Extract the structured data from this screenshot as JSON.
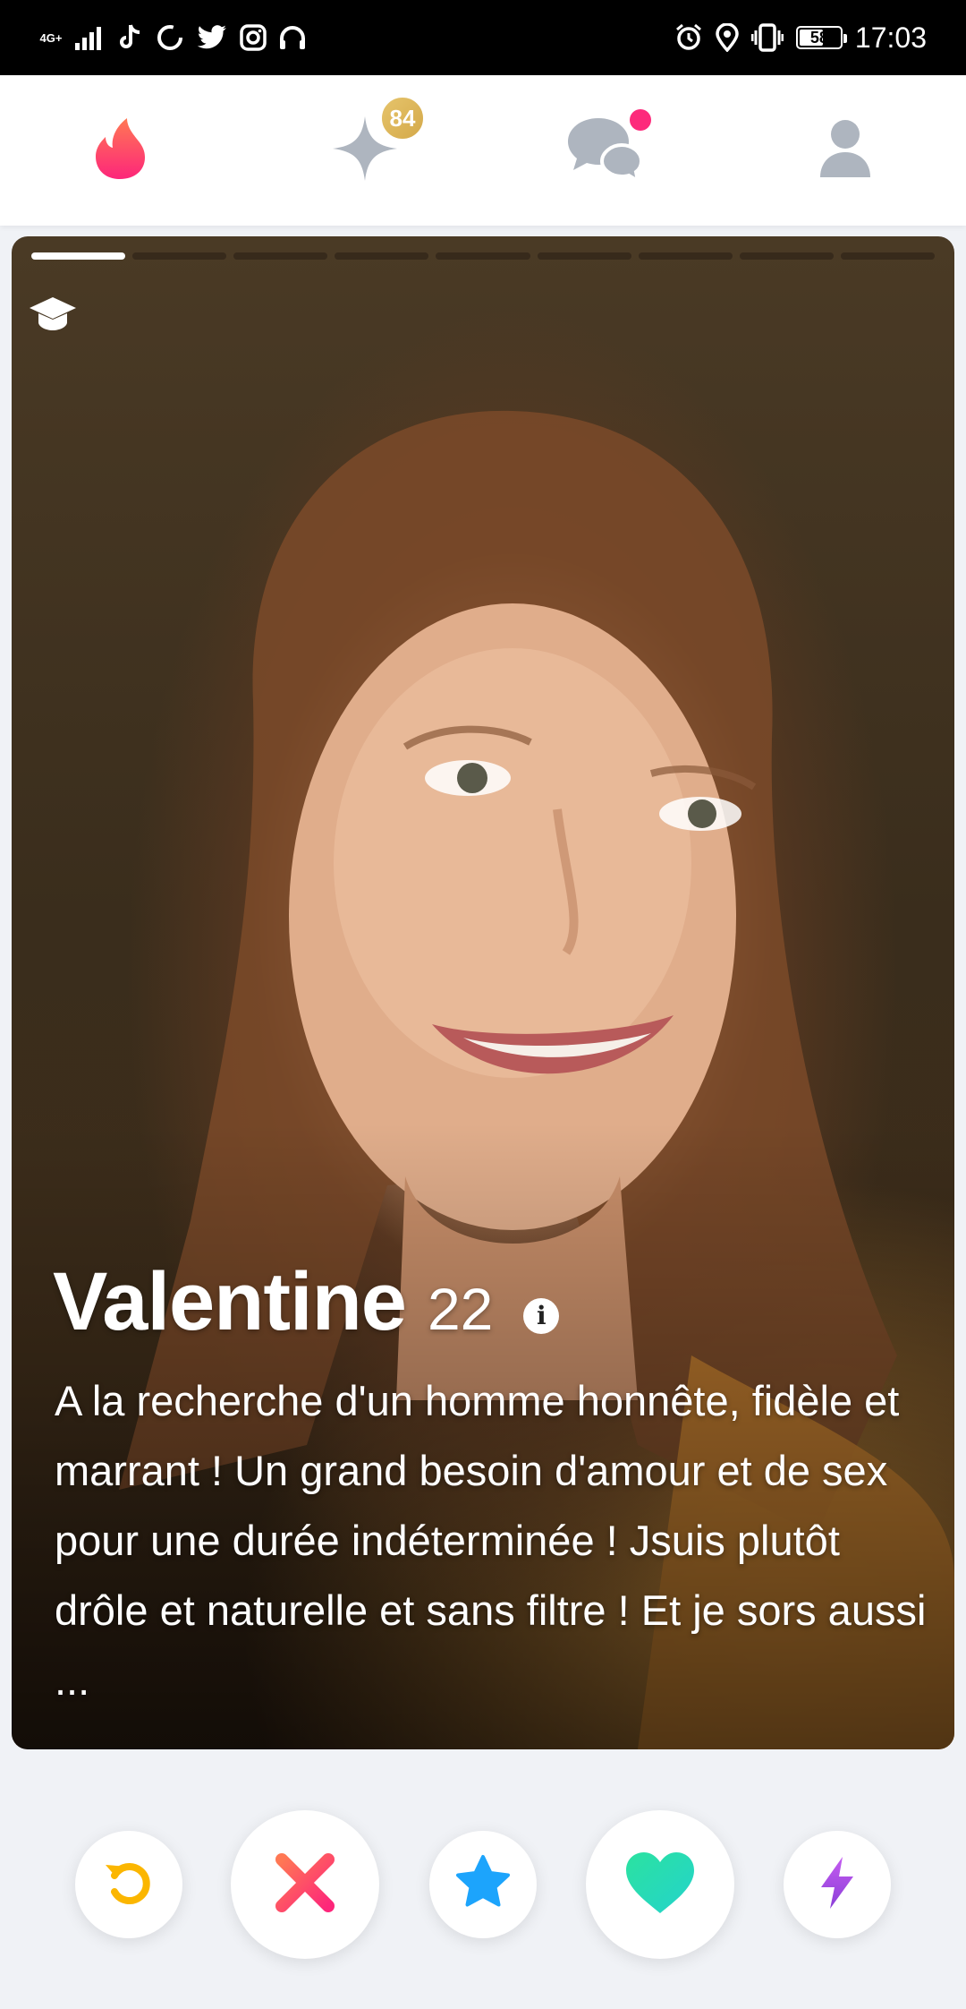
{
  "status_bar": {
    "network": "4G+",
    "icons": [
      "signal-icon",
      "tiktok-icon",
      "sync-icon",
      "twitter-icon",
      "instagram-icon",
      "headphones-icon"
    ],
    "right_icons": [
      "alarm-icon",
      "location-icon",
      "vibrate-icon"
    ],
    "battery": "58",
    "battery_level": 0.58,
    "time": "17:03"
  },
  "top_nav": {
    "items": [
      {
        "name": "flame-icon",
        "color": "#fd5564"
      },
      {
        "name": "gold-sparkle-icon",
        "badge": "84"
      },
      {
        "name": "messages-icon"
      },
      {
        "name": "profile-icon"
      }
    ]
  },
  "profile": {
    "photo_count": 9,
    "active_photo": 1,
    "name": "Valentine",
    "age": "22",
    "info_glyph": "i",
    "bio": "A la recherche d'un homme honnête, fidèle et marrant ! Un grand besoin d'amour et de sex pour une durée indéterminée ! Jsuis plutôt drôle et naturelle et sans filtre ! Et je sors aussi ..."
  },
  "actions": [
    {
      "name": "rewind-button",
      "color": "#fbb600"
    },
    {
      "name": "nope-button",
      "color": "#fd5068"
    },
    {
      "name": "super-like-button",
      "color": "#1ca4fc"
    },
    {
      "name": "like-button",
      "color": "#2ce5b0"
    },
    {
      "name": "boost-button",
      "color": "#a653e0"
    }
  ]
}
